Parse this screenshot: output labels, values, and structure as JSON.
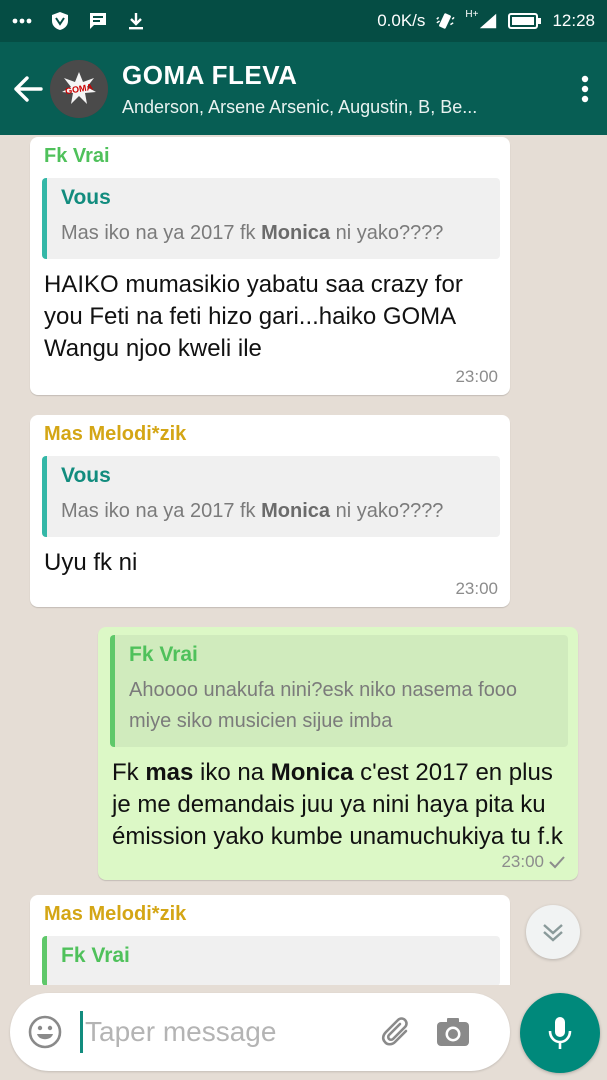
{
  "status_bar": {
    "net_speed": "0.0K/s",
    "network_type": "H+",
    "time": "12:28",
    "icons": [
      "more-dots-icon",
      "shield-icon",
      "message-icon",
      "download-icon",
      "vibrate-icon",
      "signal-icon",
      "battery-icon"
    ]
  },
  "header": {
    "title": "GOMA FLEVA",
    "subtitle": "Anderson, Arsene Arsenic, Augustin, B, Be...",
    "avatar_text": "GOMA"
  },
  "messages": [
    {
      "sender": "Fk Vrai",
      "sender_color": "#4fc15b",
      "quote_author": "Vous",
      "quote_author_color": "#128c7e",
      "quote_text_a": "Mas iko na ya 2017 fk ",
      "quote_text_b": "Monica",
      "quote_text_c": " ni yako????",
      "text": "HAIKO mumasikio yabatu saa crazy for you  Feti na feti hizo gari...haiko GOMA Wangu njoo kweli ile",
      "time": "23:00"
    },
    {
      "sender": "Mas Melodi*zik",
      "sender_color": "#d4a615",
      "quote_author": "Vous",
      "quote_author_color": "#128c7e",
      "quote_text_a": "Mas iko na ya 2017 fk ",
      "quote_text_b": "Monica",
      "quote_text_c": " ni yako????",
      "text": "Uyu fk ni",
      "time": "23:00"
    },
    {
      "quote_author": "Fk Vrai",
      "quote_author_color": "#4fc15b",
      "quote_text": "Ahoooo unakufa nini?esk niko nasema fooo miye siko musicien sijue imba",
      "text_1": "Fk ",
      "text_2": "mas",
      "text_3": " iko na ",
      "text_4": "Monica",
      "text_5": " c'est 2017 en plus je me demandais juu ya nini haya pita ku émission yako kumbe unamuchukiya tu f.k",
      "time": "23:00"
    },
    {
      "sender": "Mas Melodi*zik",
      "sender_color": "#d4a615",
      "quote_author": "Fk Vrai",
      "quote_author_color": "#4fc15b"
    }
  ],
  "input": {
    "placeholder": "Taper message"
  },
  "colors": {
    "app_bar": "#075e54",
    "status_bar": "#054d44",
    "chat_bg": "#e5ddd5",
    "outgoing_bubble": "#dcf8c6",
    "mic_button": "#00897b"
  }
}
